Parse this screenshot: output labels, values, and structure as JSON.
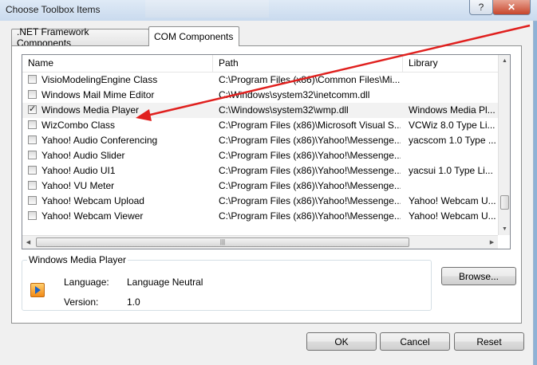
{
  "window": {
    "title": "Choose Toolbox Items",
    "help_label": "?",
    "close_label": "✕"
  },
  "tabs": [
    {
      "label": ".NET Framework Components"
    },
    {
      "label": "COM Components"
    }
  ],
  "list": {
    "columns": [
      "Name",
      "Path",
      "Library"
    ],
    "rows": [
      {
        "checked": false,
        "name": "VisioModelingEngine Class",
        "path": "C:\\Program Files (x86)\\Common Files\\Mi...",
        "library": ""
      },
      {
        "checked": false,
        "name": "Windows Mail Mime Editor",
        "path": "C:\\Windows\\system32\\inetcomm.dll",
        "library": ""
      },
      {
        "checked": true,
        "name": "Windows Media Player",
        "path": "C:\\Windows\\system32\\wmp.dll",
        "library": "Windows Media Pl..."
      },
      {
        "checked": false,
        "name": "WizCombo Class",
        "path": "C:\\Program Files (x86)\\Microsoft Visual S...",
        "library": "VCWiz 8.0 Type Li..."
      },
      {
        "checked": false,
        "name": "Yahoo! Audio Conferencing",
        "path": "C:\\Program Files (x86)\\Yahoo!\\Messenge...",
        "library": "yacscom 1.0 Type ..."
      },
      {
        "checked": false,
        "name": "Yahoo! Audio Slider",
        "path": "C:\\Program Files (x86)\\Yahoo!\\Messenge...",
        "library": ""
      },
      {
        "checked": false,
        "name": "Yahoo! Audio UI1",
        "path": "C:\\Program Files (x86)\\Yahoo!\\Messenge...",
        "library": "yacsui 1.0 Type Li..."
      },
      {
        "checked": false,
        "name": "Yahoo! VU Meter",
        "path": "C:\\Program Files (x86)\\Yahoo!\\Messenge...",
        "library": ""
      },
      {
        "checked": false,
        "name": "Yahoo! Webcam Upload",
        "path": "C:\\Program Files (x86)\\Yahoo!\\Messenge...",
        "library": "Yahoo! Webcam U..."
      },
      {
        "checked": false,
        "name": "Yahoo! Webcam Viewer",
        "path": "C:\\Program Files (x86)\\Yahoo!\\Messenge...",
        "library": "Yahoo! Webcam U..."
      }
    ],
    "check_mark": "✓",
    "scroll": {
      "up": "▲",
      "down": "▼",
      "left": "◀",
      "right": "▶",
      "grip": "|||"
    }
  },
  "details": {
    "group_title": "Windows Media Player",
    "language_label": "Language:",
    "language_value": "Language Neutral",
    "version_label": "Version:",
    "version_value": "1.0",
    "icon": "windows-media-player-icon"
  },
  "buttons": {
    "browse": "Browse...",
    "ok": "OK",
    "cancel": "Cancel",
    "reset": "Reset"
  },
  "annotation": {
    "arrow_color": "#e0201e"
  }
}
